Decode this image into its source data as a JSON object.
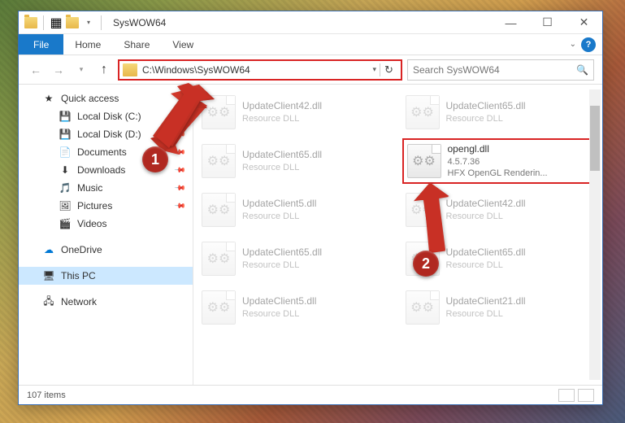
{
  "window": {
    "title": "SysWOW64"
  },
  "ribbon": {
    "file": "File",
    "tabs": [
      "Home",
      "Share",
      "View"
    ]
  },
  "nav": {
    "address": "C:\\Windows\\SysWOW64",
    "search_placeholder": "Search SysWOW64"
  },
  "sidebar": {
    "quick_access": "Quick access",
    "items": [
      {
        "label": "Local Disk (C:)",
        "icon": "💾",
        "pin": true
      },
      {
        "label": "Local Disk (D:)",
        "icon": "💾",
        "pin": true
      },
      {
        "label": "Documents",
        "icon": "📄",
        "pin": true
      },
      {
        "label": "Downloads",
        "icon": "⬇",
        "pin": true
      },
      {
        "label": "Music",
        "icon": "🎵",
        "pin": true
      },
      {
        "label": "Pictures",
        "icon": "🖼",
        "pin": true
      },
      {
        "label": "Videos",
        "icon": "🎬",
        "pin": false
      }
    ],
    "onedrive": "OneDrive",
    "thispc": "This PC",
    "network": "Network"
  },
  "files": [
    {
      "name": "UpdateClient42.dll",
      "sub1": "Resource DLL",
      "sub2": ""
    },
    {
      "name": "UpdateClient65.dll",
      "sub1": "Resource DLL",
      "sub2": ""
    },
    {
      "name": "UpdateClient65.dll",
      "sub1": "Resource DLL",
      "sub2": ""
    },
    {
      "name": "opengl.dll",
      "sub1": "4.5.7.36",
      "sub2": "HFX OpenGL Renderin...",
      "highlighted": true
    },
    {
      "name": "UpdateClient5.dll",
      "sub1": "Resource DLL",
      "sub2": ""
    },
    {
      "name": "UpdateClient42.dll",
      "sub1": "Resource DLL",
      "sub2": ""
    },
    {
      "name": "UpdateClient65.dll",
      "sub1": "Resource DLL",
      "sub2": ""
    },
    {
      "name": "UpdateClient65.dll",
      "sub1": "Resource DLL",
      "sub2": ""
    },
    {
      "name": "UpdateClient5.dll",
      "sub1": "Resource DLL",
      "sub2": ""
    },
    {
      "name": "UpdateClient21.dll",
      "sub1": "Resource DLL",
      "sub2": ""
    }
  ],
  "status": {
    "count": "107 items"
  },
  "annotations": {
    "step1": "1",
    "step2": "2"
  }
}
